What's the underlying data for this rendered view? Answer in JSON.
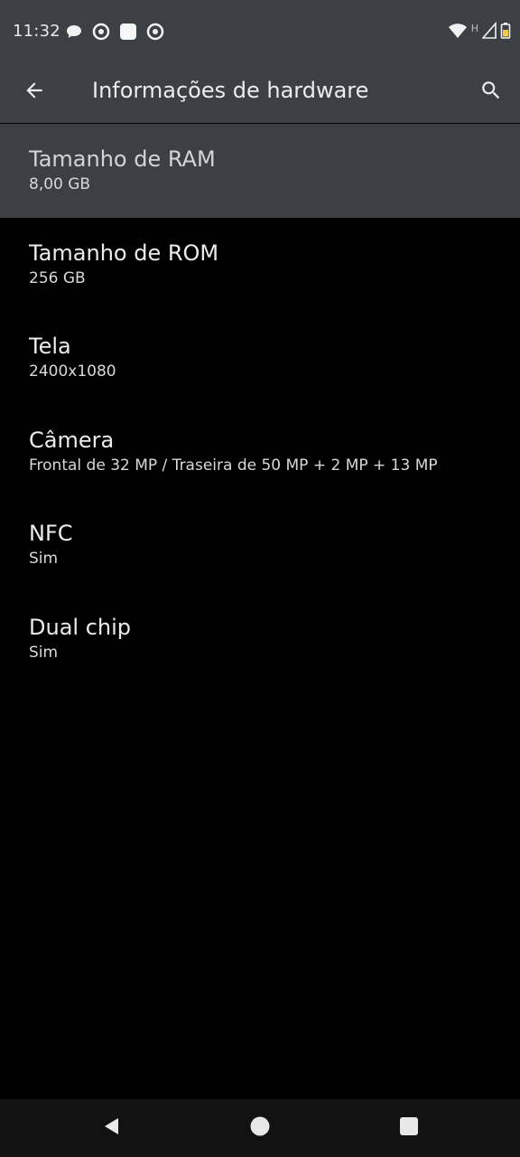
{
  "status_bar": {
    "time": "11:32",
    "notification_icons": [
      "chat-bubble-icon",
      "chrome-icon",
      "app-square-icon",
      "chrome-icon"
    ],
    "network_type": "H",
    "system_icons": [
      "wifi-icon",
      "signal-icon",
      "battery-icon"
    ]
  },
  "app_bar": {
    "title": "Informações de hardware",
    "back_icon": "arrow-back-icon",
    "search_icon": "search-icon"
  },
  "items": [
    {
      "title": "Tamanho de RAM",
      "value": "8,00 GB",
      "selected": true
    },
    {
      "title": "Tamanho de ROM",
      "value": "256 GB",
      "selected": false
    },
    {
      "title": "Tela",
      "value": "2400x1080",
      "selected": false
    },
    {
      "title": "Câmera",
      "value": "Frontal de 32 MP / Traseira de 50 MP + 2 MP + 13 MP",
      "selected": false
    },
    {
      "title": "NFC",
      "value": "Sim",
      "selected": false
    },
    {
      "title": "Dual chip",
      "value": "Sim",
      "selected": false
    }
  ],
  "nav_bar": {
    "buttons": [
      "back-triangle-icon",
      "home-circle-icon",
      "recents-square-icon"
    ]
  },
  "colors": {
    "bar_background": "#3c4044",
    "list_background": "#000000",
    "nav_background": "#121212",
    "text_primary": "#ececec"
  }
}
